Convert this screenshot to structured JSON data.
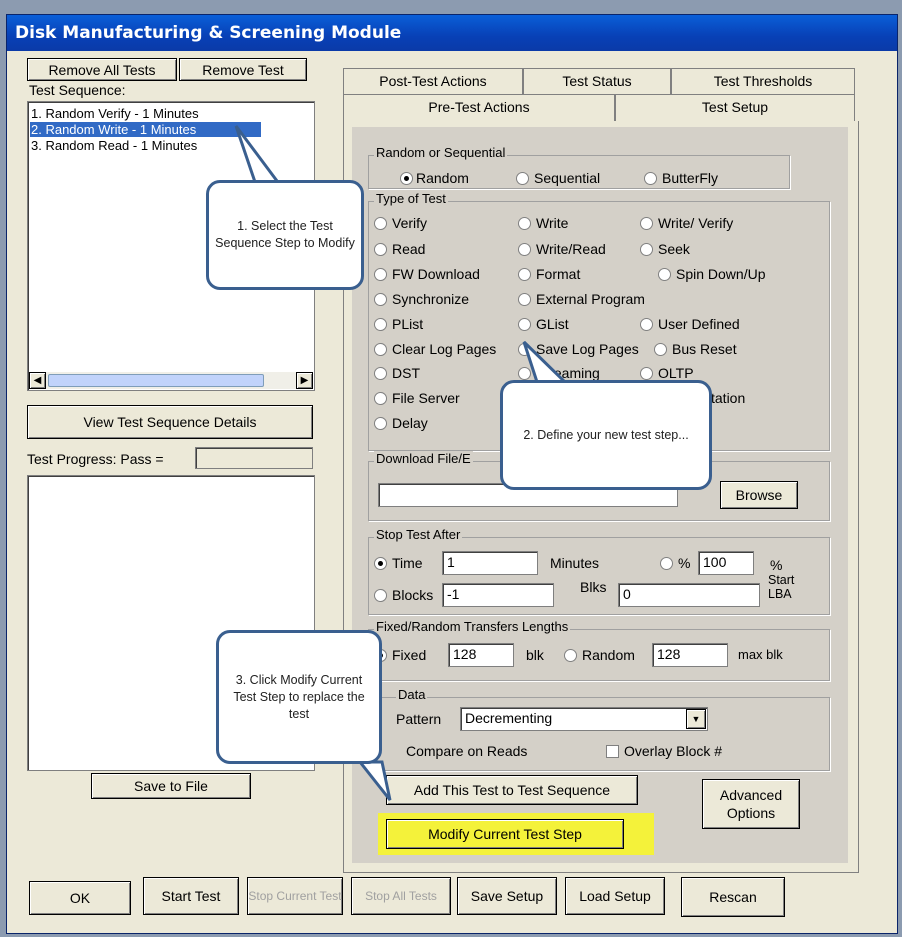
{
  "window": {
    "title": "Disk Manufacturing & Screening Module"
  },
  "left": {
    "remove_all": "Remove All Tests",
    "remove_test": "Remove Test",
    "sequence_label": "Test Sequence:",
    "sequence": [
      "1. Random  Verify  - 1 Minutes",
      "2. Random  Write  - 1 Minutes",
      "3. Random  Read  - 1 Minutes"
    ],
    "view_details": "View Test Sequence Details",
    "progress_label": "Test Progress:  Pass =",
    "save_to_file": "Save to File"
  },
  "tabs": {
    "row1": [
      "Post-Test Actions",
      "Test Status",
      "Test Thresholds"
    ],
    "row2": [
      "Pre-Test Actions",
      "Test Setup"
    ]
  },
  "setup": {
    "random_seq_label": "Random or Sequential",
    "random_seq": [
      "Random",
      "Sequential",
      "ButterFly"
    ],
    "type_label": "Type of Test",
    "types": [
      "Verify",
      "Write",
      "Write/ Verify",
      "Read",
      "Write/Read",
      "Seek",
      "FW Download",
      "Format",
      "Spin Down/Up",
      "Synchronize",
      "External Program",
      "PList",
      "GList",
      "User Defined",
      "Clear Log Pages",
      "Save Log Pages",
      "Bus Reset",
      "DST",
      "Streaming",
      "OLTP",
      "File Server",
      "station",
      "Delay"
    ],
    "download_label": "Download File/E",
    "browse": "Browse",
    "stop_label": "Stop Test After",
    "time_label": "Time",
    "time_value": "1",
    "minutes": "Minutes",
    "pct_label": "%",
    "pct_value": "100",
    "pct_suffix": "%",
    "start_lba": "Start LBA",
    "blocks_label": "Blocks",
    "blocks_value": "-1",
    "blks": "Blks",
    "blks_value": "0",
    "fixed_label": "Fixed/Random Transfers Lengths",
    "fixed": "Fixed",
    "fixed_value": "128",
    "blk": "blk",
    "random": "Random",
    "random_value": "128",
    "max_blk": "max blk",
    "data_label": "Data",
    "pattern_label": "Pattern",
    "pattern_value": "Decrementing",
    "compare_label": "Compare on Reads",
    "overlay_label": "Overlay Block #",
    "add_test": "Add This Test to Test Sequence",
    "modify_step": "Modify Current Test Step",
    "advanced": "Advanced Options"
  },
  "bottom": {
    "ok": "OK",
    "start_test": "Start Test",
    "stop_current": "Stop Current Test",
    "stop_all": "Stop All Tests",
    "save_setup": "Save Setup",
    "load_setup": "Load Setup",
    "rescan": "Rescan"
  },
  "callouts": {
    "c1": "1. Select the Test Sequence Step to Modify",
    "c2": "2. Define your new test step...",
    "c3": "3. Click Modify Current Test Step to replace the test"
  },
  "colors": {
    "title_bar": "#0a47c4",
    "selection": "#316ac5",
    "highlight": "#f4f23a",
    "callout_border": "#3a5f8f"
  }
}
